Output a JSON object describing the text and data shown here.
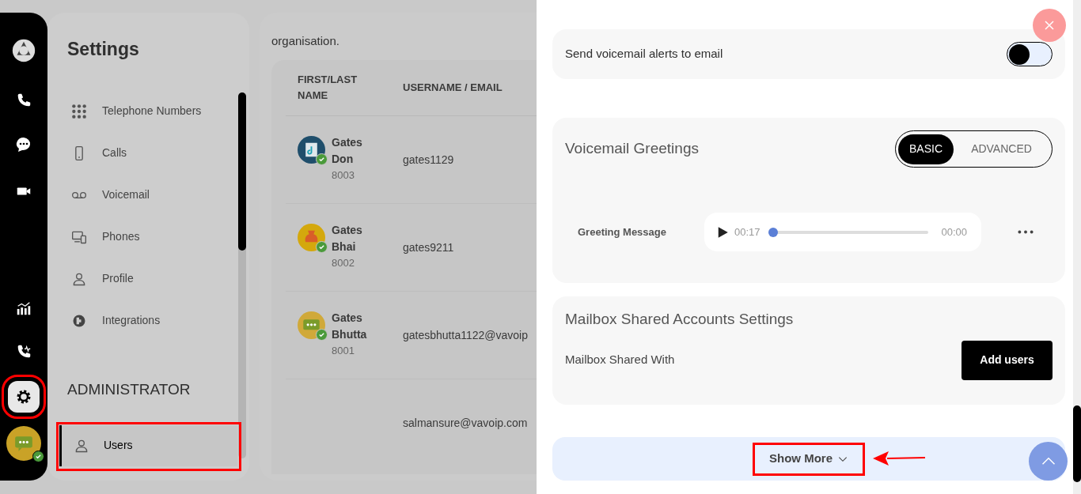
{
  "rail": {
    "items": [
      {
        "selected": false,
        "annotated": false
      },
      {
        "selected": false,
        "annotated": false
      },
      {
        "selected": false,
        "annotated": false
      },
      {
        "selected": false,
        "annotated": false
      },
      {
        "selected": false,
        "annotated": false
      },
      {
        "selected": false,
        "annotated": false
      },
      {
        "selected": true,
        "annotated": true
      }
    ],
    "avatar": {
      "online": true
    }
  },
  "settings": {
    "title": "Settings",
    "items": [
      {
        "label": "Telephone Numbers",
        "selected": false,
        "annotated": false
      },
      {
        "label": "Calls",
        "selected": false,
        "annotated": false
      },
      {
        "label": "Voicemail",
        "selected": false,
        "annotated": false
      },
      {
        "label": "Phones",
        "selected": false,
        "annotated": false
      },
      {
        "label": "Profile",
        "selected": false,
        "annotated": false
      },
      {
        "label": "Integrations",
        "selected": false,
        "annotated": false
      }
    ],
    "admin_heading": "ADMINISTRATOR",
    "admin_items": [
      {
        "label": "Users",
        "selected": true,
        "annotated": true
      }
    ]
  },
  "users": {
    "intro": "organisation.",
    "table": {
      "columns": [
        "FIRST/LAST NAME",
        "USERNAME / EMAIL"
      ],
      "rows": [
        {
          "first": "Gates",
          "last": "Don",
          "extension": "8003",
          "username": "gates1129",
          "online": true
        },
        {
          "first": "Gates",
          "last": "Bhai",
          "extension": "8002",
          "username": "gates9211",
          "online": true
        },
        {
          "first": "Gates",
          "last": "Bhutta",
          "extension": "8001",
          "username": "gatesbhutta1122@vavoip",
          "online": true
        },
        {
          "username": "salmansure@vavoip.com"
        }
      ]
    }
  },
  "drawer": {
    "alerts": {
      "label": "Send voicemail alerts to email",
      "on": false
    },
    "greetings": {
      "title": "Voicemail Greetings",
      "modes": [
        {
          "label": "BASIC",
          "selected": true
        },
        {
          "label": "ADVANCED",
          "selected": false
        }
      ],
      "message": {
        "label": "Greeting Message",
        "elapsed": "00:17",
        "remaining": "00:00",
        "level": 0
      }
    },
    "shared": {
      "title": "Mailbox Shared Accounts Settings",
      "label": "Mailbox Shared With",
      "button": "Add users"
    },
    "show_more": {
      "label": "Show More",
      "annotated": true
    }
  }
}
